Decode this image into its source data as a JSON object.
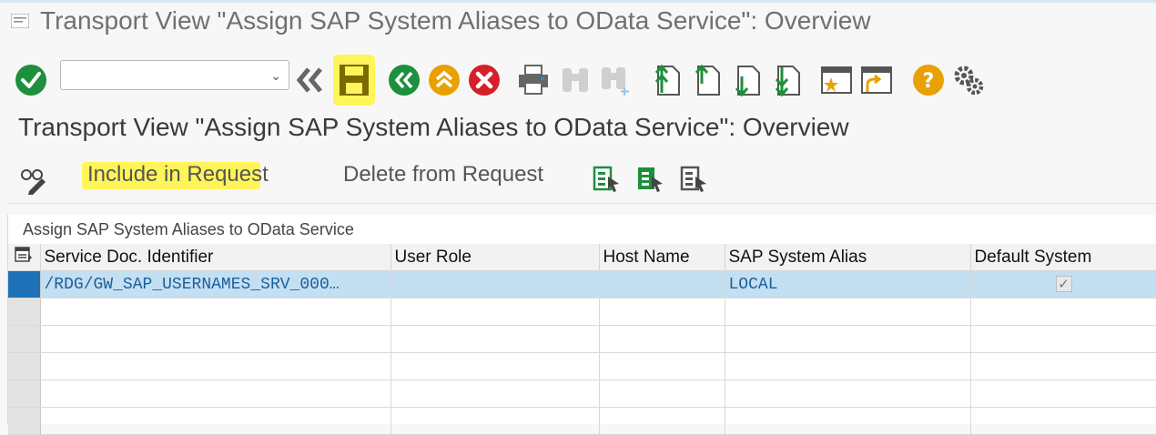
{
  "window": {
    "title": "Transport View \"Assign SAP System Aliases to OData Service\": Overview"
  },
  "toolbar": {
    "command_field": {
      "value": "",
      "placeholder": ""
    },
    "icons": [
      "enter-icon",
      "back-double-chevron-icon",
      "save-icon",
      "back-icon",
      "exit-icon",
      "cancel-icon",
      "print-icon",
      "find-icon",
      "find-next-icon",
      "first-page-icon",
      "previous-page-icon",
      "next-page-icon",
      "last-page-icon",
      "create-session-icon",
      "create-shortcut-icon",
      "help-icon",
      "customize-layout-icon"
    ]
  },
  "page": {
    "heading": "Transport View \"Assign SAP System Aliases to OData Service\": Overview"
  },
  "app_toolbar": {
    "include_label": "Include in Request",
    "delete_label": "Delete from Request"
  },
  "table": {
    "title": "Assign SAP System Aliases to OData Service",
    "columns": [
      "Service Doc. Identifier",
      "User Role",
      "Host Name",
      "SAP System Alias",
      "Default System"
    ],
    "rows": [
      {
        "service_doc_identifier": "/RDG/GW_SAP_USERNAMES_SRV_000…",
        "user_role": "",
        "host_name": "",
        "sap_system_alias": "LOCAL",
        "default_system": "✓"
      }
    ]
  },
  "colors": {
    "highlight": "#fff45a",
    "selected_row": "#c3dff2",
    "row_selector_active": "#1f71b8",
    "link_text": "#1b5f9c"
  }
}
